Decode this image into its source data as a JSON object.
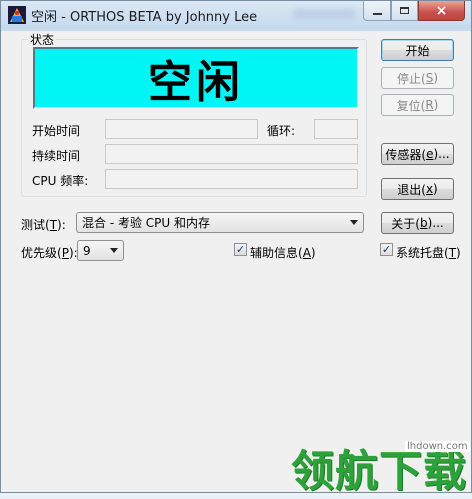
{
  "window": {
    "title": "空闲 - ORTHOS BETA by Johnny Lee",
    "controls": {
      "close_glyph": "×"
    }
  },
  "status_group": {
    "label": "状态",
    "display_text": "空闲",
    "display_color": "#00f5f5"
  },
  "info": {
    "start_time_label": "开始时间",
    "loop_label": "循环:",
    "duration_label": "持续时间",
    "cpu_freq_label": "CPU 频率:",
    "start_time_value": "",
    "loop_value": "",
    "duration_value": "",
    "cpu_freq_value": ""
  },
  "buttons": {
    "start": "开始",
    "stop": "停止(",
    "stop_key": "S",
    "reset": "复位(",
    "reset_key": "R",
    "sensors": "传感器(",
    "sensors_key": "e",
    "sensors_suffix": ")...",
    "exit": "退出(",
    "exit_key": "x",
    "about": "关于(",
    "about_key": "b",
    "about_suffix": ")..."
  },
  "test": {
    "label": "测试(",
    "label_key": "T",
    "selected": "混合 - 考验 CPU 和内存"
  },
  "priority": {
    "label": "优先级(",
    "label_key": "P",
    "selected": "9"
  },
  "options": {
    "aux_info_label": "辅助信息(",
    "aux_info_key": "A",
    "aux_info_checked": true,
    "tray_label": "系统托盘(",
    "tray_key": "T",
    "tray_checked": true,
    "check_glyph": "✓"
  },
  "watermark": {
    "brand": "领航下载",
    "url": "lhdown.com",
    "color": "#2ea23a"
  }
}
